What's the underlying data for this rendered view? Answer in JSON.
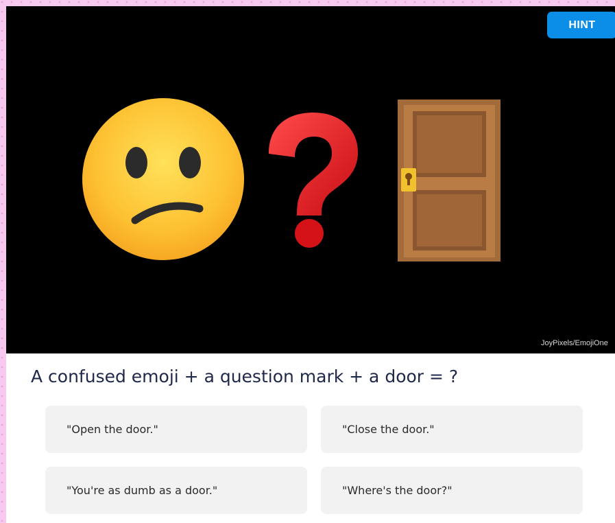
{
  "hint_label": "HINT",
  "image_credit": "JoyPixels/EmojiOne",
  "question": "A confused emoji + a question mark + a door = ?",
  "answers": [
    "\"Open the door.\"",
    "\"Close the door.\"",
    "\"You're as dumb as a door.\"",
    "\"Where's the door?\""
  ],
  "colors": {
    "page_background": "#f7c8f0",
    "hint_button": "#0b8ee8",
    "question_text": "#20294a",
    "answer_background": "#f2f2f3"
  },
  "icons": [
    "confused-face-icon",
    "question-mark-icon",
    "door-icon"
  ]
}
